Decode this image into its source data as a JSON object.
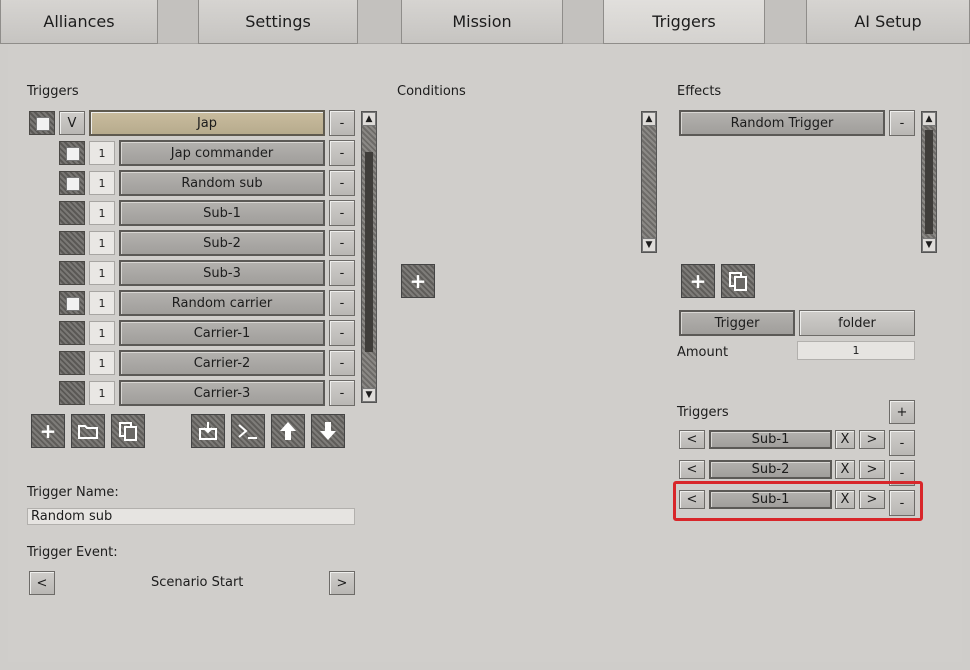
{
  "tabs": [
    "Alliances",
    "Settings",
    "Mission",
    "Triggers",
    "AI Setup"
  ],
  "active_tab": "Triggers",
  "triggers_panel": {
    "title": "Triggers",
    "group": {
      "toggle": "V",
      "name": "Jap",
      "remove": "-"
    },
    "items": [
      {
        "count": "1",
        "name": "Jap commander",
        "remove": "-"
      },
      {
        "count": "1",
        "name": "Random sub",
        "remove": "-"
      },
      {
        "count": "1",
        "name": "Sub-1",
        "remove": "-"
      },
      {
        "count": "1",
        "name": "Sub-2",
        "remove": "-"
      },
      {
        "count": "1",
        "name": "Sub-3",
        "remove": "-"
      },
      {
        "count": "1",
        "name": "Random carrier",
        "remove": "-"
      },
      {
        "count": "1",
        "name": "Carrier-1",
        "remove": "-"
      },
      {
        "count": "1",
        "name": "Carrier-2",
        "remove": "-"
      },
      {
        "count": "1",
        "name": "Carrier-3",
        "remove": "-"
      }
    ]
  },
  "trigger_name": {
    "label": "Trigger Name:",
    "value": "Random sub"
  },
  "trigger_event": {
    "label": "Trigger Event:",
    "value": "Scenario Start",
    "prev": "<",
    "next": ">"
  },
  "conditions": {
    "title": "Conditions"
  },
  "effects": {
    "title": "Effects",
    "items": [
      {
        "name": "Random Trigger",
        "remove": "-"
      }
    ],
    "toggle_trigger": "Trigger",
    "toggle_folder": "folder",
    "amount_label": "Amount",
    "amount_value": "1",
    "triggers_label": "Triggers",
    "add": "+",
    "rows": [
      {
        "prev": "<",
        "name": "Sub-1",
        "clear": "X",
        "next": ">",
        "remove": "-"
      },
      {
        "prev": "<",
        "name": "Sub-2",
        "clear": "X",
        "next": ">",
        "remove": "-"
      },
      {
        "prev": "<",
        "name": "Sub-1",
        "clear": "X",
        "next": ">",
        "remove": "-"
      }
    ]
  },
  "colors": {
    "highlight": "#d8262a",
    "group_header": "#c0b396"
  }
}
